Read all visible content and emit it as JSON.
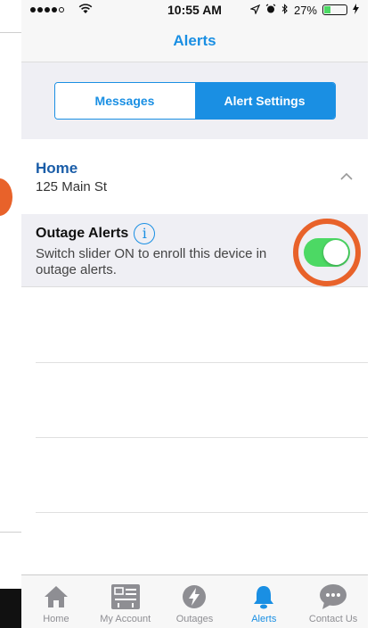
{
  "status_bar": {
    "time": "10:55 AM",
    "battery": "27%",
    "battery_level": 0.27
  },
  "nav": {
    "title": "Alerts"
  },
  "segments": {
    "messages": "Messages",
    "alert_settings": "Alert Settings",
    "selected": "alert_settings"
  },
  "location": {
    "name": "Home",
    "address": "125 Main St",
    "expanded": true
  },
  "outage_alerts": {
    "title": "Outage Alerts",
    "description": "Switch slider ON to enroll this device in outage alerts.",
    "enabled": true
  },
  "tabs": [
    {
      "label": "Home",
      "icon": "home-icon",
      "active": false
    },
    {
      "label": "My Account",
      "icon": "account-icon",
      "active": false
    },
    {
      "label": "Outages",
      "icon": "outages-icon",
      "active": false
    },
    {
      "label": "Alerts",
      "icon": "bell-icon",
      "active": true
    },
    {
      "label": "Contact Us",
      "icon": "chat-icon",
      "active": false
    }
  ],
  "colors": {
    "accent": "#1a8fe3",
    "toggle_on": "#4cd964",
    "highlight_ring": "#e8622a",
    "inactive_icon": "#8e8e93"
  }
}
